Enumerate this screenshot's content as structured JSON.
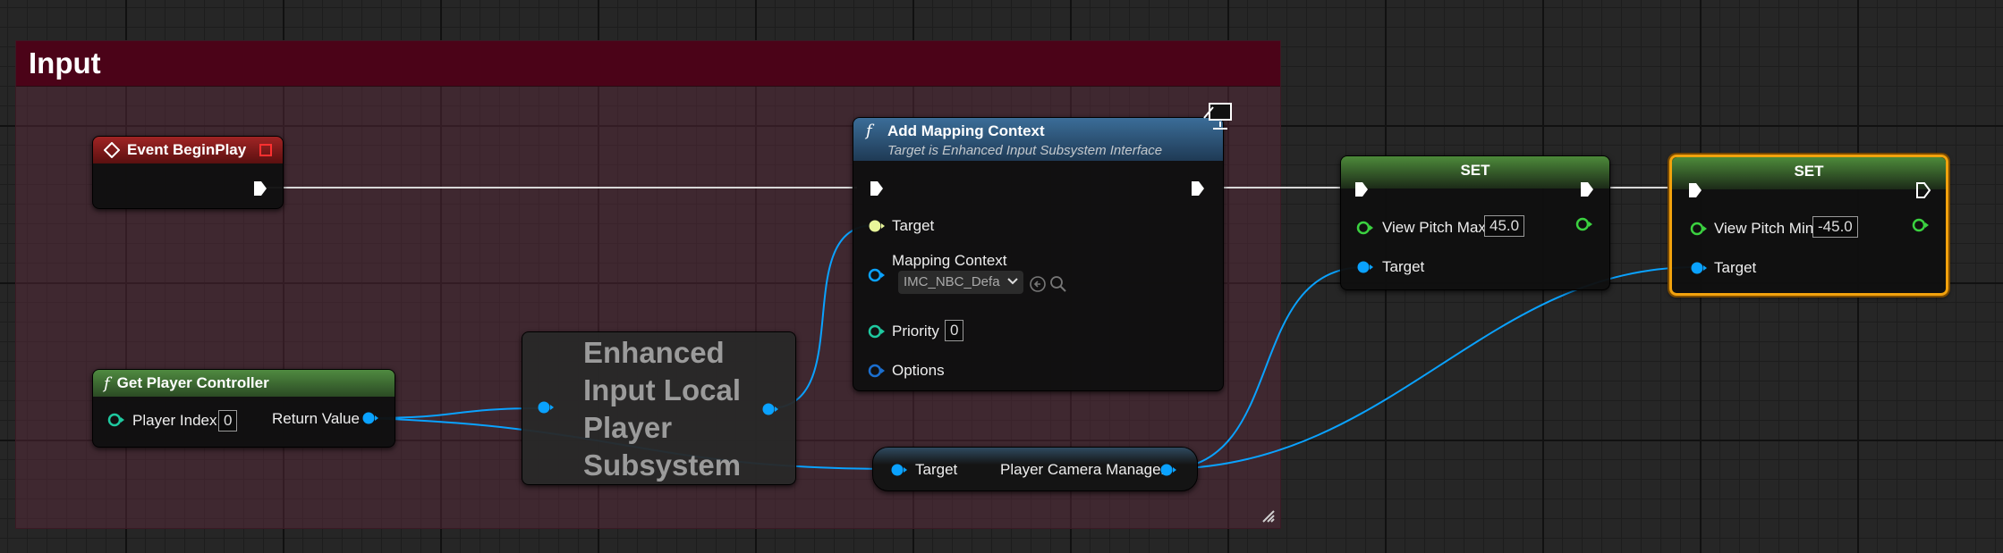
{
  "comment": {
    "title": "Input"
  },
  "nodes": {
    "event_begin_play": {
      "title": "Event BeginPlay"
    },
    "get_player_controller": {
      "title": "Get Player Controller",
      "player_index_label": "Player Index",
      "player_index_value": "0",
      "return_value_label": "Return Value"
    },
    "enhanced_subsystem": {
      "line1": "Enhanced",
      "line2": "Input Local",
      "line3": "Player",
      "line4": "Subsystem"
    },
    "add_mapping_context": {
      "title": "Add Mapping Context",
      "subtitle": "Target is Enhanced Input Subsystem Interface",
      "target_label": "Target",
      "mapping_context_label": "Mapping Context",
      "mapping_context_value": "IMC_NBC_Defa",
      "priority_label": "Priority",
      "priority_value": "0",
      "options_label": "Options"
    },
    "player_camera_manager": {
      "target_label": "Target",
      "output_label": "Player Camera Manager"
    },
    "set_pitch_max": {
      "title": "SET",
      "field_label": "View Pitch Max",
      "field_value": "45.0",
      "target_label": "Target"
    },
    "set_pitch_min": {
      "title": "SET",
      "field_label": "View Pitch Min",
      "field_value": "-45.0",
      "target_label": "Target"
    }
  },
  "icons": [
    "event-diamond-icon",
    "function-icon",
    "server-client-icon",
    "exec-pin-icon",
    "data-pin-icon",
    "dropdown-chevron-icon",
    "use-selected-icon",
    "browse-icon",
    "resize-grip-icon"
  ],
  "colors": {
    "comment_header": "#4b0318",
    "event_header": "#8b1d1d",
    "function_green": "#3f6e33",
    "function_blue": "#2f5f85",
    "object_pin": "#0aa2ff",
    "float_pin": "#3bd140",
    "struct_pin": "#1f9e78",
    "selected_outline": "#f2a20d"
  }
}
